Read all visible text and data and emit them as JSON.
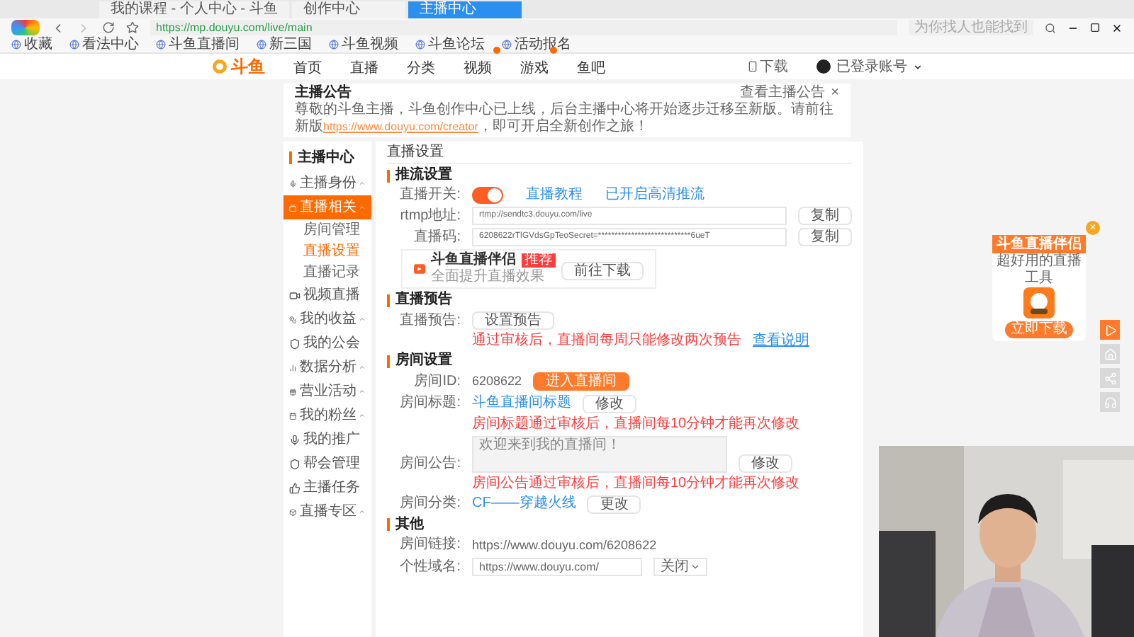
{
  "browser": {
    "tabs": [
      {
        "title": "我的课程 - 个人中心 - 斗鱼",
        "selected": false
      },
      {
        "title": "创作中心",
        "selected": false
      },
      {
        "title": "主播中心",
        "selected": true
      }
    ],
    "url": "https://mp.douyu.com/live/main",
    "search_placeholder": "为你找人也能找到",
    "bookmarks": [
      "收藏",
      "看法中心",
      "斗鱼直播间",
      "新三国",
      "斗鱼视频",
      "斗鱼论坛",
      "活动报名"
    ]
  },
  "site_nav": {
    "logo": "斗鱼",
    "items": [
      {
        "label": "首页",
        "badge": false
      },
      {
        "label": "直播",
        "badge": false
      },
      {
        "label": "分类",
        "badge": false
      },
      {
        "label": "视频",
        "badge": true
      },
      {
        "label": "游戏",
        "badge": true
      },
      {
        "label": "鱼吧",
        "badge": false
      }
    ],
    "download": "下载",
    "user": "已登录账号"
  },
  "notice": {
    "title": "主播公告",
    "more": "查看主播公告",
    "close": "×",
    "text": "尊敬的斗鱼主播，斗鱼创作中心已上线，后台主播中心将开始逐步迁移至新版。请前往新版",
    "link": "https://www.douyu.com/creator",
    "text_end": "，即可开启全新创作之旅！"
  },
  "sidebar": {
    "title": "主播中心",
    "items": [
      {
        "label": "主播身份",
        "collapsible": true,
        "selected": false
      },
      {
        "label": "直播相关",
        "collapsible": true,
        "selected": true,
        "children": [
          {
            "label": "房间管理",
            "selected": false
          },
          {
            "label": "直播设置",
            "selected": true
          },
          {
            "label": "直播记录",
            "selected": false
          }
        ]
      },
      {
        "label": "视频直播",
        "collapsible": false,
        "selected": false
      },
      {
        "label": "我的收益",
        "collapsible": true,
        "selected": false
      },
      {
        "label": "我的公会",
        "collapsible": false,
        "selected": false
      },
      {
        "label": "数据分析",
        "collapsible": true,
        "selected": false
      },
      {
        "label": "营业活动",
        "collapsible": true,
        "selected": false
      },
      {
        "label": "我的粉丝",
        "collapsible": true,
        "selected": false
      },
      {
        "label": "我的推广",
        "collapsible": false,
        "selected": false
      },
      {
        "label": "帮会管理",
        "collapsible": false,
        "selected": false
      },
      {
        "label": "主播任务",
        "collapsible": false,
        "selected": false
      },
      {
        "label": "直播专区",
        "collapsible": true,
        "selected": false
      }
    ]
  },
  "main": {
    "title": "直播设置",
    "sections": [
      {
        "title": "推流设置",
        "rows": [
          {
            "kind": "toggle",
            "label": "直播开关:",
            "on": true,
            "links": [
              "直播教程",
              "已开启高清推流"
            ]
          },
          {
            "kind": "field",
            "label": "rtmp地址:",
            "value": "rtmp://sendtc3.douyu.com/live",
            "button": "复制"
          },
          {
            "kind": "field",
            "label": "直播码:",
            "value": "6208622rTlGVdsGpTeoSecret=****************************6ueT",
            "button": "复制"
          },
          {
            "kind": "promo",
            "title": "斗鱼直播伴侣",
            "badge": "推荐",
            "subtitle": "全面提升直播效果",
            "button": "前往下载"
          }
        ]
      },
      {
        "title": "直播预告",
        "rows": [
          {
            "kind": "action",
            "label": "直播预告:",
            "button": "设置预告",
            "primary": false
          },
          {
            "kind": "note",
            "text": "通过审核后，直播间每周只能修改两次预告",
            "link": "查看说明"
          }
        ]
      },
      {
        "title": "房间设置",
        "rows": [
          {
            "kind": "action",
            "label": "房间ID:",
            "value": "6208622",
            "button": "进入直播间",
            "primary": true
          },
          {
            "kind": "link",
            "label": "房间标题:",
            "value": "斗鱼直播间标题",
            "button": "修改"
          },
          {
            "kind": "note",
            "text": "房间标题通过审核后，直播间每10分钟才能再次修改"
          },
          {
            "kind": "textarea",
            "label": "房间公告:",
            "value": "欢迎来到我的直播间！",
            "button": "修改"
          },
          {
            "kind": "note",
            "text": "房间公告通过审核后，直播间每10分钟才能再次修改"
          },
          {
            "kind": "link",
            "label": "房间分类:",
            "value": "CF——穿越火线",
            "button": "更改"
          }
        ]
      },
      {
        "title": "其他",
        "rows": [
          {
            "kind": "text",
            "label": "房间链接:",
            "value": "https://www.douyu.com/6208622"
          },
          {
            "kind": "domain",
            "label": "个性域名:",
            "value": "https://www.douyu.com/",
            "select": "关闭"
          }
        ]
      }
    ]
  },
  "float_ad": {
    "title": "斗鱼直播伴侣",
    "subtitle": "超好用的直播工具",
    "button": "立即下载",
    "close": "×"
  },
  "side_tools": [
    {
      "selected": true
    },
    {
      "selected": false
    },
    {
      "selected": false
    },
    {
      "selected": false
    }
  ]
}
